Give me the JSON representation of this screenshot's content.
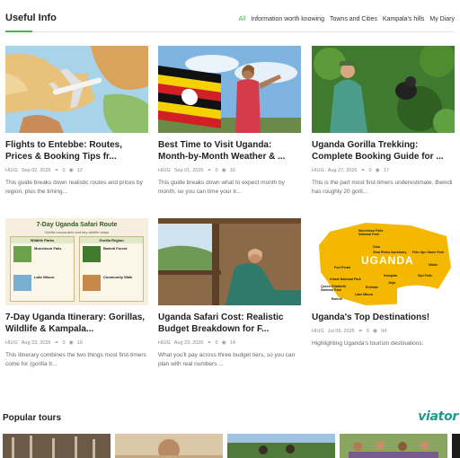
{
  "section": {
    "title": "Useful Info"
  },
  "tabs": [
    {
      "label": "All",
      "active": true
    },
    {
      "label": "Information worth knowing"
    },
    {
      "label": "Towns and Cities"
    },
    {
      "label": "Kampala's hills"
    },
    {
      "label": "My Diary"
    }
  ],
  "articles": [
    {
      "title": "Flights to Entebbe: Routes, Prices & Booking Tips fr...",
      "author": "HIUG",
      "date": "Sep 02, 2026",
      "comments": "0",
      "views": "12",
      "excerpt": "This guide breaks down realistic routes and prices by region, plus the timing...",
      "image": "map-airplane"
    },
    {
      "title": "Best Time to Visit Uganda: Month-by-Month Weather & ...",
      "author": "HIUG",
      "date": "Sep 01, 2026",
      "comments": "0",
      "views": "16",
      "excerpt": "This guide breaks down what to expect month by month, so you can time your tr...",
      "image": "uganda-flag-woman"
    },
    {
      "title": "Uganda Gorilla Trekking: Complete Booking Guide for ...",
      "author": "HIUG",
      "date": "Aug 27, 2026",
      "comments": "0",
      "views": "17",
      "excerpt": "This is the part most first-timers underestimate. Bwindi has roughly 20 goril...",
      "image": "gorilla-trek"
    },
    {
      "title": "7-Day Uganda Itinerary: Gorillas, Wildlife & Kampala...",
      "author": "HIUG",
      "date": "Aug 23, 2026",
      "comments": "0",
      "views": "16",
      "excerpt": "This itinerary combines the two things most first-timers come for (gorilla tr...",
      "image": "safari-route"
    },
    {
      "title": "Uganda Safari Cost: Realistic Budget Breakdown for F...",
      "author": "HIUG",
      "date": "Aug 23, 2026",
      "comments": "0",
      "views": "14",
      "excerpt": "What you'll pay across three budget tiers, so you can plan with real numbers ...",
      "image": "lodge-woman"
    },
    {
      "title": "Uganda's Top Destinations!",
      "author": "HIUG",
      "date": "Jul 05, 2025",
      "comments": "0",
      "views": "94",
      "excerpt": "Highlighting Uganda's tourism destinations:",
      "image": "uganda-map"
    }
  ],
  "infographic": {
    "title": "7-Day Uganda Safari Route",
    "subtitle": "Gorilla encounters and key wildlife stops",
    "left_heading": "Wildlife Parks",
    "right_heading": "Gorilla Region",
    "left_items": [
      "Murchison Falls",
      "Lake Mburo"
    ],
    "right_items": [
      "Bwindi Forest",
      "Community Walk"
    ]
  },
  "map": {
    "country": "UGANDA",
    "places": [
      "Murchison Falls National Park",
      "Pian Upe Game Park",
      "Fort Portal",
      "Kibale National Park",
      "Queen Elizabeth National Park",
      "Entebbe",
      "Bwindi",
      "Lake Mburo",
      "Jinja",
      "Mbale",
      "Sipi Falls",
      "Gulu",
      "Ziwa Rhino Sanctuary",
      "Kampala"
    ]
  },
  "popular": {
    "title": "Popular tours",
    "partner": "viator"
  },
  "colors": {
    "accent": "#4caf50",
    "viator": "#1f9a8a",
    "map_yellow": "#f5b800"
  }
}
